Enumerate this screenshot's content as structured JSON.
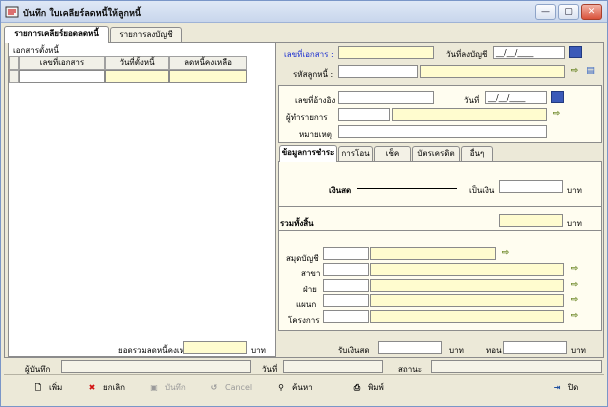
{
  "window": {
    "title": "บันทึก ใบเคลียร์ลดหนี้ให้ลูกหนี้",
    "min": "—",
    "max": "▢",
    "close": "✕"
  },
  "tabs": [
    "รายการเคลียร์ยอดลดหนี้",
    "รายการลงบัญชี"
  ],
  "left": {
    "group_title": "เอกสารตั้งหนี้",
    "columns": [
      "เลขที่เอกสาร",
      "วันที่ตั้งหนี้",
      "ลดหนี้คงเหลือ"
    ],
    "total_label": "ยอดรวมลดหนี้คงเหลือ",
    "total_unit": "บาท"
  },
  "header": {
    "doc_no_label": "เลขที่เอกสาร :",
    "posting_date_label": "วันที่ลงบัญชี",
    "posting_date_value": "__/__/____",
    "debtor_label": "รหัสลูกหนี้ :"
  },
  "refs": {
    "ref_no_label": "เลขที่อ้างอิง",
    "date_label": "วันที่",
    "date_value": "__/__/____",
    "maker_label": "ผู้ทำรายการ",
    "remark_label": "หมายเหตุ"
  },
  "pay_tabs": [
    "ข้อมูลการชำระ",
    "การโอน",
    "เช็ค",
    "บัตรเครดิต",
    "อื่นๆ"
  ],
  "payment": {
    "cash_label": "เงินสด",
    "amount_label": "เป็นเงิน",
    "unit": "บาท",
    "total_label": "รวมทั้งสิ้น",
    "book_label": "สมุดบัญชี",
    "branch_label": "สาขา",
    "division_label": "ฝ่าย",
    "dept_label": "แผนก",
    "project_label": "โครงการ",
    "received_label": "รับเงินสด",
    "change_label": "ทอน"
  },
  "footer": {
    "recorder_label": "ผู้บันทึก",
    "date_label": "วันที่",
    "status_label": "สถานะ"
  },
  "toolbar": {
    "add": "เพิ่ม",
    "cancel_doc": "ยกเลิก",
    "save": "บันทึก",
    "cancel": "Cancel",
    "search": "ค้นหา",
    "print": "พิมพ์",
    "close": "ปิด"
  },
  "colors": {
    "field_yellow": "#fffccf",
    "label_blue": "#1a2ed0",
    "window_bg": "#ece9d8"
  }
}
